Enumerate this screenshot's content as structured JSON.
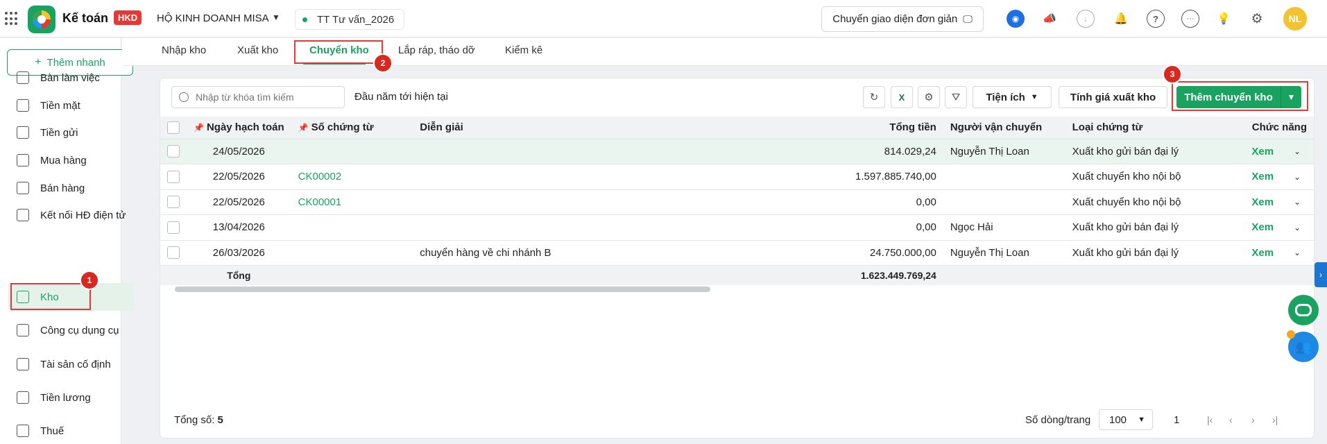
{
  "app": {
    "name": "Kế toán",
    "badge": "HKD",
    "business": "HỘ KINH DOANH MISA",
    "period": "TT Tư vấn_2026",
    "switch_ui": "Chuyển giao diện đơn giản",
    "avatar": "NL"
  },
  "topbar_icons": [
    "robot-icon",
    "megaphone-icon",
    "download-icon",
    "bell-icon",
    "help-icon",
    "more-icon",
    "lightbulb-icon",
    "settings-icon"
  ],
  "sidebar": {
    "quick_add": "Thêm nhanh",
    "items": [
      {
        "label": "Bàn làm việc",
        "icon": "dashboard-icon"
      },
      {
        "label": "Tiền mặt",
        "icon": "cash-icon"
      },
      {
        "label": "Tiền gửi",
        "icon": "card-icon"
      },
      {
        "label": "Mua hàng",
        "icon": "cart-icon"
      },
      {
        "label": "Bán hàng",
        "icon": "tag-icon"
      },
      {
        "label": "Kết nối HĐ điện tử",
        "icon": "invoice-icon"
      },
      {
        "label": "Kho",
        "icon": "box-icon",
        "active": true
      },
      {
        "label": "Công cụ dụng cụ",
        "icon": "tools-icon"
      },
      {
        "label": "Tài sản cố định",
        "icon": "truck-icon"
      },
      {
        "label": "Tiền lương",
        "icon": "salary-icon"
      },
      {
        "label": "Thuế",
        "icon": "tax-icon"
      }
    ]
  },
  "tabs": [
    {
      "label": "Nhập kho"
    },
    {
      "label": "Xuất kho"
    },
    {
      "label": "Chuyển kho",
      "active": true
    },
    {
      "label": "Lắp ráp, tháo dỡ"
    },
    {
      "label": "Kiểm kê"
    }
  ],
  "annotations": [
    "1",
    "2",
    "3"
  ],
  "toolbar": {
    "search_placeholder": "Nhập từ khóa tìm kiếm",
    "date_range": "Đầu năm tới hiện tại",
    "utilities": "Tiện ích",
    "calc_price": "Tính giá xuất kho",
    "add": "Thêm chuyển kho"
  },
  "table": {
    "columns": [
      "Ngày hạch toán",
      "Số chứng từ",
      "Diễn giải",
      "Tổng tiền",
      "Người vận chuyển",
      "Loại chứng từ",
      "Chức năng"
    ],
    "rows": [
      {
        "date": "24/05/2026",
        "doc": "",
        "desc": "",
        "total": "814.029,24",
        "carrier": "Nguyễn Thị Loan",
        "type": "Xuất kho gửi bán đại lý",
        "action": "Xem"
      },
      {
        "date": "22/05/2026",
        "doc": "CK00002",
        "desc": "",
        "total": "1.597.885.740,00",
        "carrier": "",
        "type": "Xuất chuyển kho nội bộ",
        "action": "Xem"
      },
      {
        "date": "22/05/2026",
        "doc": "CK00001",
        "desc": "",
        "total": "0,00",
        "carrier": "",
        "type": "Xuất chuyển kho nội bộ",
        "action": "Xem"
      },
      {
        "date": "13/04/2026",
        "doc": "",
        "desc": "",
        "total": "0,00",
        "carrier": "Ngọc Hải",
        "type": "Xuất kho gửi bán đại lý",
        "action": "Xem"
      },
      {
        "date": "26/03/2026",
        "doc": "",
        "desc": "chuyển hàng về chi nhánh B",
        "total": "24.750.000,00",
        "carrier": "Nguyễn Thị Loan",
        "type": "Xuất kho gửi bán đại lý",
        "action": "Xem"
      }
    ],
    "footer_label": "Tổng",
    "footer_total": "1.623.449.769,24"
  },
  "footer": {
    "total_label": "Tổng số:",
    "total_count": "5",
    "rows_label": "Số dòng/trang",
    "rows_per_page": "100",
    "page": "1"
  },
  "colors": {
    "accent": "#1aa260",
    "annotation": "#e53935"
  }
}
